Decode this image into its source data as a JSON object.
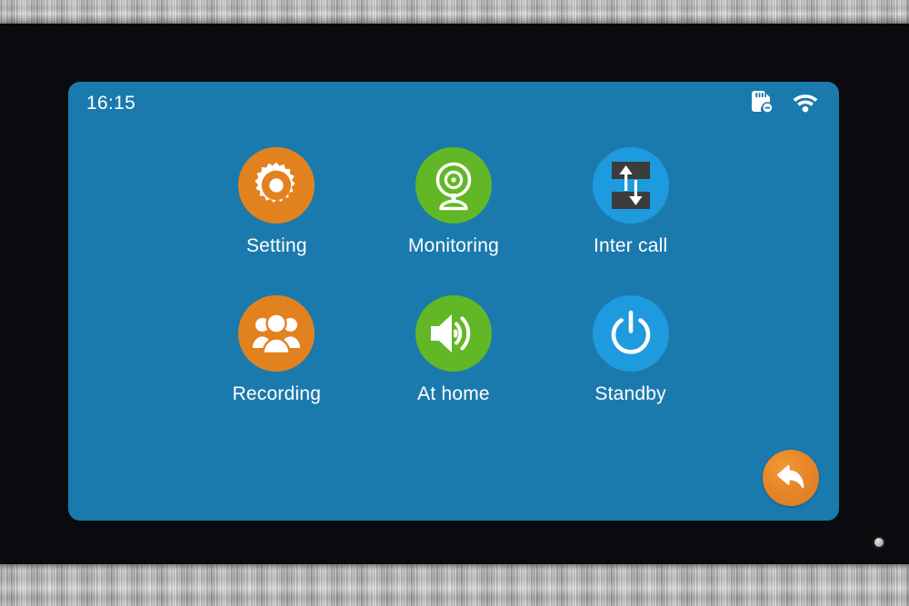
{
  "device": {
    "name": "video-intercom-monitor",
    "frame_color": "#a8a8a8",
    "bezel_color": "#0b0b0f",
    "led_indicator": "power-led"
  },
  "screen": {
    "background_color": "#1b7aad",
    "status_bar": {
      "clock": "16:15",
      "icons": [
        {
          "name": "sd-card-removed-icon",
          "label": "SD card not inserted"
        },
        {
          "name": "wifi-icon",
          "label": "Wi-Fi connected"
        }
      ]
    },
    "home": {
      "apps": [
        {
          "label": "Setting",
          "icon": "gear-icon",
          "color": "#e2821f",
          "selected": true
        },
        {
          "label": "Monitoring",
          "icon": "webcam-icon",
          "color": "#62b726",
          "selected": false
        },
        {
          "label": "Inter call",
          "icon": "transfer-icon",
          "color": "#1e9ade",
          "selected": false
        },
        {
          "label": "Recording",
          "icon": "people-icon",
          "color": "#e2821f",
          "selected": false
        },
        {
          "label": "At home",
          "icon": "speaker-icon",
          "color": "#62b726",
          "selected": false
        },
        {
          "label": "Standby",
          "icon": "power-icon",
          "color": "#1e9ade",
          "selected": false
        }
      ],
      "back_button": {
        "label": "Back",
        "icon": "back-arrow-icon",
        "color": "#e8862a"
      }
    }
  }
}
